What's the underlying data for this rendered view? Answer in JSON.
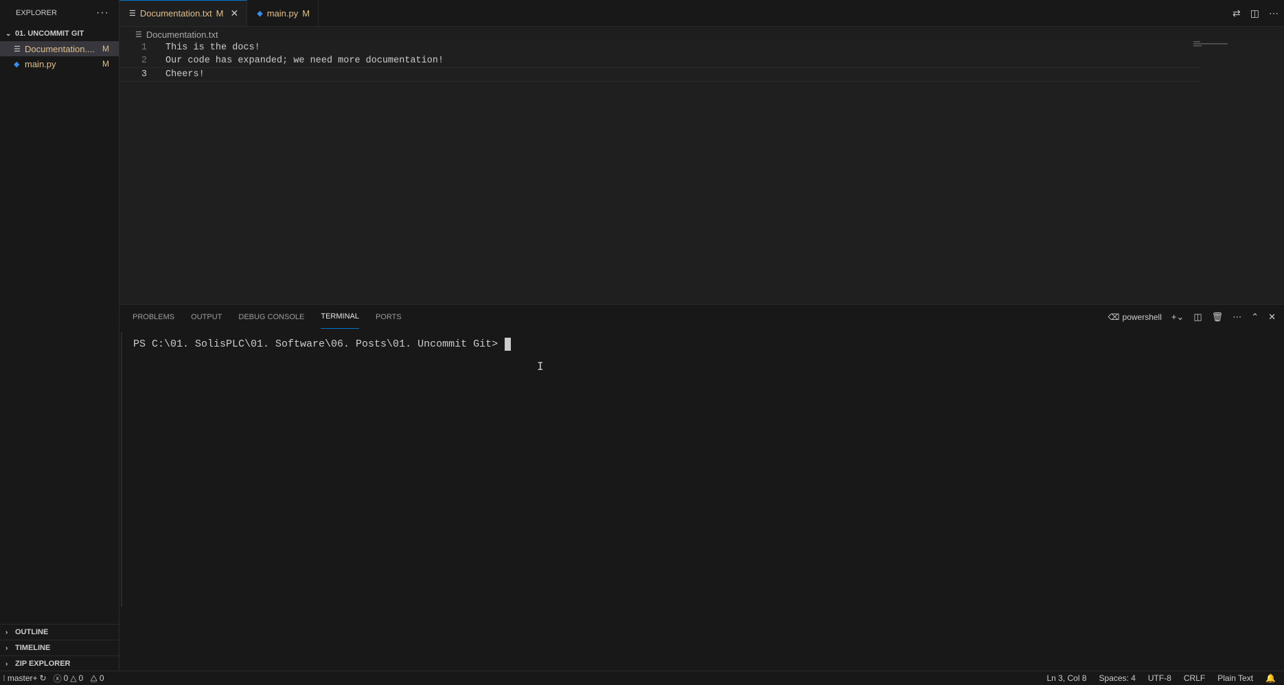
{
  "sidebar": {
    "title": "EXPLORER",
    "more": "···",
    "folder": "01. UNCOMMIT GIT",
    "files": [
      {
        "name": "Documentation....",
        "badge": "M"
      },
      {
        "name": "main.py",
        "badge": "M"
      }
    ],
    "sections": [
      "OUTLINE",
      "TIMELINE",
      "ZIP EXPLORER"
    ]
  },
  "tabs": [
    {
      "label": "Documentation.txt",
      "badge": "M"
    },
    {
      "label": "main.py",
      "badge": "M"
    }
  ],
  "breadcrumb": "Documentation.txt",
  "editor": {
    "lines": [
      {
        "num": "1",
        "text": "This is the docs!"
      },
      {
        "num": "2",
        "text": "Our code has expanded; we need more documentation!"
      },
      {
        "num": "3",
        "text": "Cheers!"
      }
    ]
  },
  "panel": {
    "tabs": [
      "PROBLEMS",
      "OUTPUT",
      "DEBUG CONSOLE",
      "TERMINAL",
      "PORTS"
    ],
    "shell": "powershell",
    "prompt": "PS C:\\01. SolisPLC\\01. Software\\06. Posts\\01. Uncommit Git> "
  },
  "status": {
    "branch": "master+",
    "errors": "0",
    "warnings": "0",
    "ports": "0",
    "position": "Ln 3, Col 8",
    "spaces": "Spaces: 4",
    "encoding": "UTF-8",
    "eol": "CRLF",
    "language": "Plain Text"
  },
  "colors": {
    "accent": "#0078d4",
    "modified": "#e2c08d"
  }
}
